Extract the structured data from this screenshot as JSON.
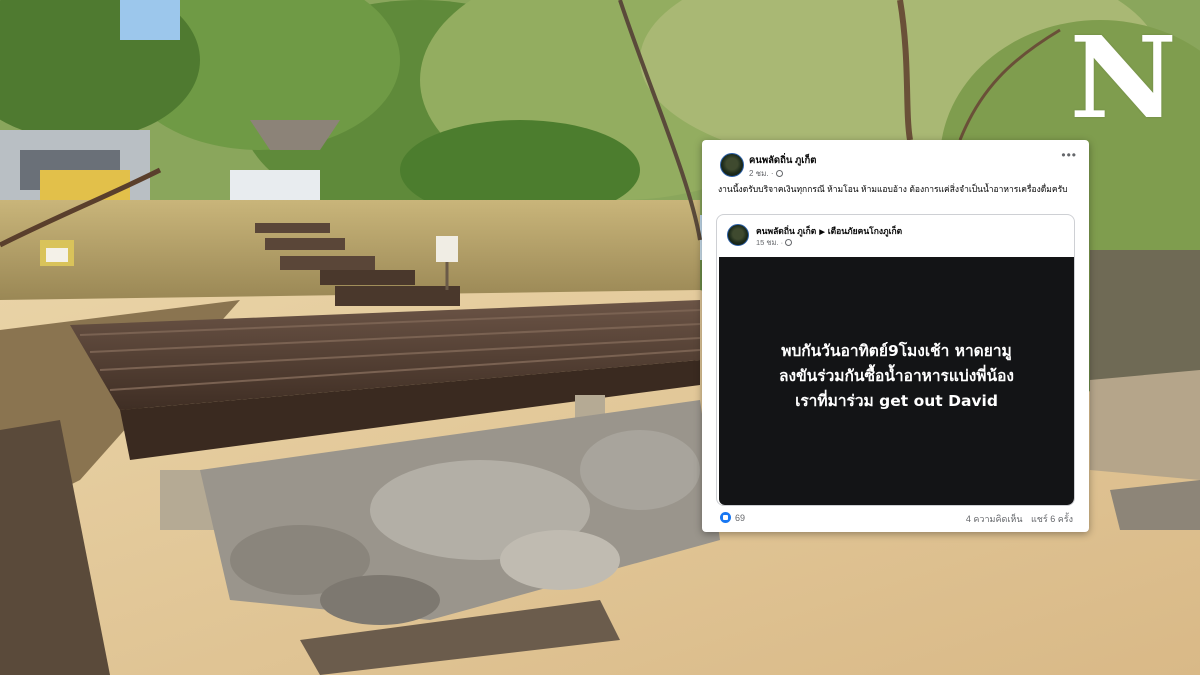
{
  "logo": {
    "text": "N",
    "color": "#ffffff"
  },
  "post": {
    "author": "คนพลัดถิ่น ภูเก็ต",
    "time": "2 ชม.",
    "more_icon": "more-horizontal-icon",
    "text": "งานนี้งดรับบริจาคเงินทุกกรณี ห้ามโอน ห้ามแอบอ้าง ต้องการแค่สิ่งจำเป็นน้ำอาหารเครื่องดื่มครับ",
    "shared": {
      "author": "คนพลัดถิ่น ภูเก็ต",
      "group": "เตือนภัยคนโกงภูเก็ต",
      "time": "15 ชม.",
      "bg_text": "พบกันวันอาทิตย์9โมงเช้า หาดยามู\nลงขันร่วมกันซื้อน้ำอาหารแบ่งพี่น้อง\nเราที่มาร่วม get out David",
      "bg_color": "#131416"
    },
    "reactions_count": "69",
    "comments": "4 ความคิดเห็น",
    "shares": "แชร์ 6 ครั้ง",
    "accent": "#1877f2"
  }
}
